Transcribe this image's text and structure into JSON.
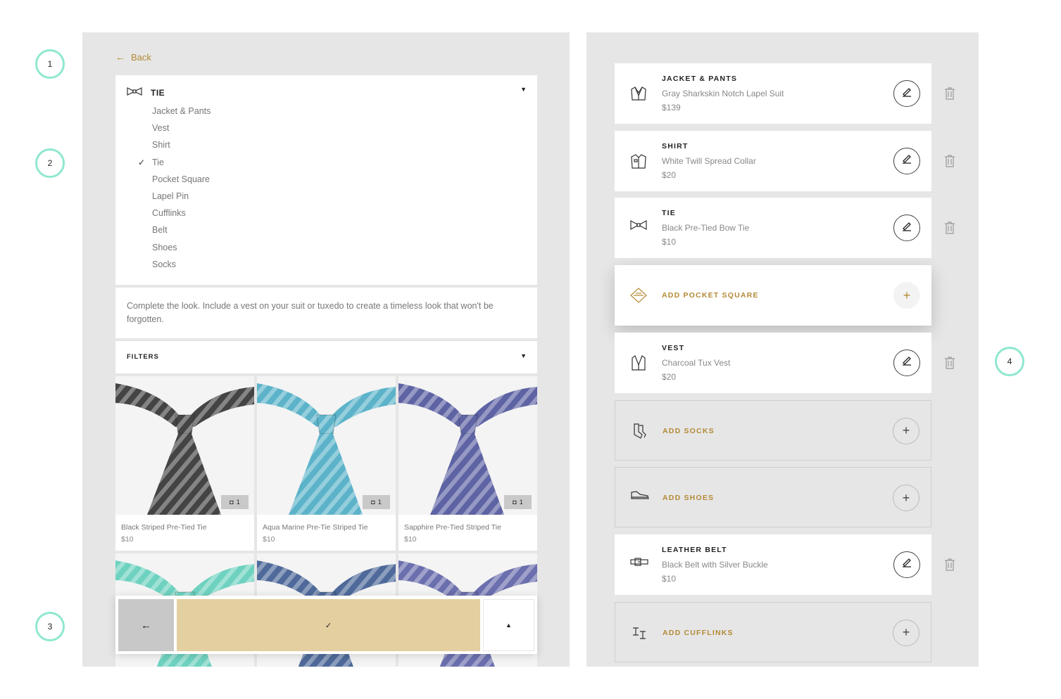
{
  "markers": [
    "1",
    "2",
    "3",
    "4"
  ],
  "left": {
    "back_label": "Back",
    "category_title": "TIE",
    "categories": [
      "Jacket & Pants",
      "Vest",
      "Shirt",
      "Tie",
      "Pocket Square",
      "Lapel Pin",
      "Cufflinks",
      "Belt",
      "Shoes",
      "Socks"
    ],
    "selected_category": "Tie",
    "info_text": "Complete the look. Include a vest on your suit or tuxedo to create a timeless look that won't be forgotten.",
    "filters_label": "FILTERS",
    "products": [
      {
        "name": "Black Striped Pre-Tied Tie",
        "price": "$10",
        "photo_count": "1",
        "color": "#444444"
      },
      {
        "name": "Aqua Marine Pre-Tie Striped Tie",
        "price": "$10",
        "photo_count": "1",
        "color": "#5cb3c9"
      },
      {
        "name": "Sapphire Pre-Tied Striped Tie",
        "price": "$10",
        "photo_count": "1",
        "color": "#5d63a3"
      }
    ],
    "second_row_colors": [
      "#6fd2c0",
      "#4f6a9a",
      "#6b6fae"
    ]
  },
  "right": {
    "items": [
      {
        "type": "filled",
        "category": "JACKET & PANTS",
        "description": "Gray Sharkskin Notch Lapel Suit",
        "price": "$139",
        "icon": "jacket-icon"
      },
      {
        "type": "filled",
        "category": "SHIRT",
        "description": "White Twill Spread Collar",
        "price": "$20",
        "icon": "shirt-icon"
      },
      {
        "type": "filled",
        "category": "TIE",
        "description": "Black Pre-Tied Bow Tie",
        "price": "$10",
        "icon": "bowtie-icon"
      },
      {
        "type": "highlight",
        "add_label": "ADD POCKET SQUARE",
        "icon": "pocket-square-icon"
      },
      {
        "type": "filled",
        "category": "VEST",
        "description": "Charcoal Tux Vest",
        "price": "$20",
        "icon": "vest-icon"
      },
      {
        "type": "empty",
        "add_label": "ADD SOCKS",
        "icon": "socks-icon"
      },
      {
        "type": "empty",
        "add_label": "ADD SHOES",
        "icon": "shoe-icon"
      },
      {
        "type": "filled",
        "category": "LEATHER BELT",
        "description": "Black Belt with Silver Buckle",
        "price": "$10",
        "icon": "belt-icon"
      },
      {
        "type": "empty",
        "add_label": "ADD CUFFLINKS",
        "icon": "cufflinks-icon"
      }
    ]
  },
  "colors": {
    "accent": "#b38a36",
    "confirm": "#e3cf9f",
    "marker": "#8fe8cf",
    "panel": "#e6e6e6"
  }
}
